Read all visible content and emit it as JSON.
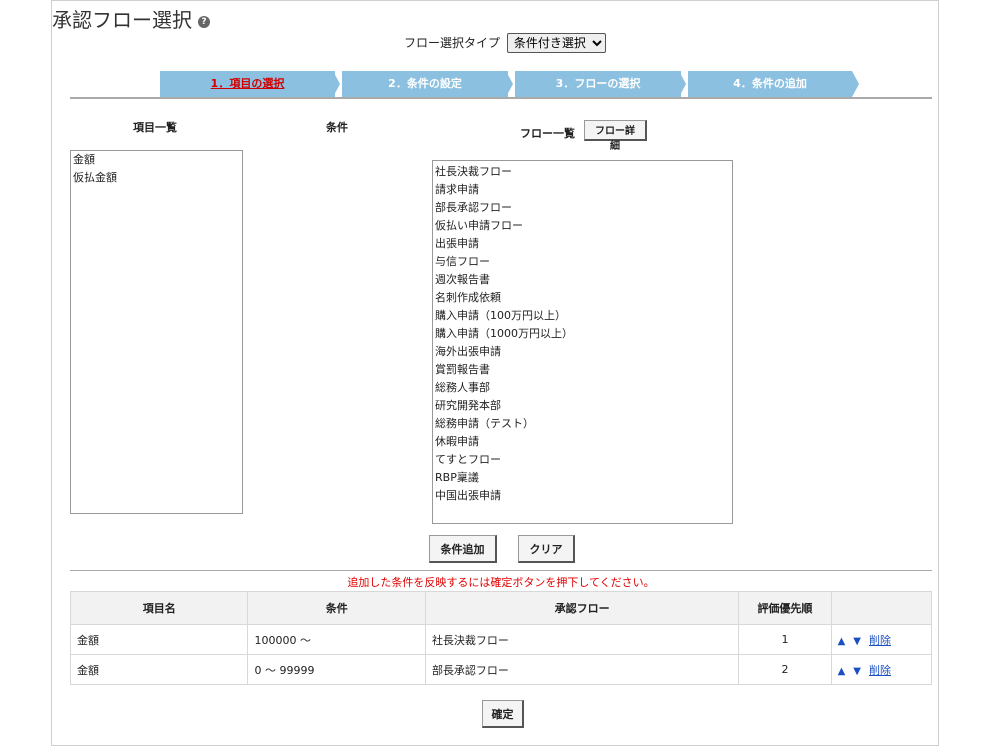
{
  "header": {
    "title": "承認フロー選択",
    "help_icon": "?"
  },
  "flow_type": {
    "label": "フロー選択タイプ",
    "selected": "条件付き選択"
  },
  "steps": [
    {
      "label": "1．項目の選択",
      "active": true
    },
    {
      "label": "2．条件の設定",
      "active": false
    },
    {
      "label": "3．フローの選択",
      "active": false
    },
    {
      "label": "4．条件の追加",
      "active": false
    }
  ],
  "columns": {
    "items": "項目一覧",
    "conditions": "条件",
    "flows": "フロー一覧"
  },
  "buttons": {
    "flow_detail": "フロー詳細",
    "add_condition": "条件追加",
    "clear": "クリア",
    "confirm": "確定"
  },
  "item_list": [
    "金額",
    "仮払金額"
  ],
  "flow_list": [
    "社長決裁フロー",
    "請求申請",
    "部長承認フロー",
    "仮払い申請フロー",
    "出張申請",
    "与信フロー",
    "週次報告書",
    "名刺作成依頼",
    "購入申請（100万円以上）",
    "購入申請（1000万円以上）",
    "海外出張申請",
    "賞罰報告書",
    "総務人事部",
    "研究開発本部",
    "総務申請（テスト）",
    "休暇申請",
    "てすとフロー",
    "RBP稟議",
    "中国出張申請"
  ],
  "note": "追加した条件を反映するには確定ボタンを押下してください。",
  "table": {
    "headers": [
      "項目名",
      "条件",
      "承認フロー",
      "評価優先順",
      ""
    ],
    "rows": [
      {
        "item": "金額",
        "condition": "100000 ～",
        "flow": "社長決裁フロー",
        "priority": "1",
        "up": "▲",
        "down": "▼",
        "delete": "削除"
      },
      {
        "item": "金額",
        "condition": "0 ～ 99999",
        "flow": "部長承認フロー",
        "priority": "2",
        "up": "▲",
        "down": "▼",
        "delete": "削除"
      }
    ]
  },
  "colors": {
    "step_bg": "#8cc0e0",
    "active_step_text": "#d00000",
    "note_text": "#e00000",
    "link": "#1a4fc4"
  }
}
